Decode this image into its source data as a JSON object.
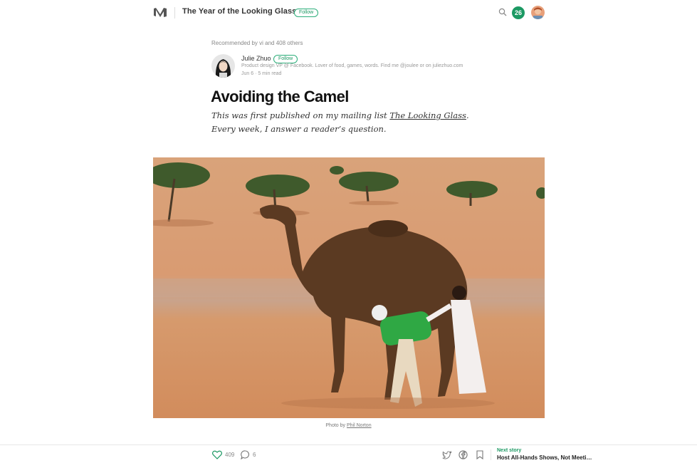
{
  "header": {
    "publication_title": "The Year of the Looking Glass",
    "follow_label": "Follow",
    "notification_count": "26",
    "logo_icon": "medium-logo-icon",
    "search_icon": "search-icon",
    "accent_color": "#1c9963"
  },
  "article": {
    "recommended_by": "Recommended by vi and 408 others",
    "author": {
      "name": "Julie Zhuo",
      "follow_label": "Follow",
      "bio": "Product design VP @ Facebook. Lover of food, games, words. Find me @joulee or on juliezhuo.com",
      "meta": "Jun 6 · 5 min read"
    },
    "title": "Avoiding the Camel",
    "intro_before": "This was first published on my mailing list ",
    "intro_link": "The Looking Glass",
    "intro_after": ". Every week, I answer a reader’s question.",
    "caption_prefix": "Photo by ",
    "caption_link": "Phil Norton"
  },
  "footer": {
    "likes": "409",
    "comments": "6",
    "next_label": "Next story",
    "next_title": "Host All-Hands Shows, Not Meeti…",
    "icons": [
      "heart-icon",
      "comment-icon",
      "twitter-icon",
      "facebook-icon",
      "bookmark-icon"
    ]
  }
}
